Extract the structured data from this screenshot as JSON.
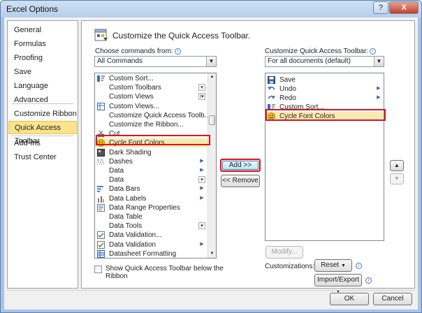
{
  "window": {
    "title": "Excel Options",
    "help": "?",
    "close": "X"
  },
  "nav": {
    "items": [
      {
        "label": "General"
      },
      {
        "label": "Formulas"
      },
      {
        "label": "Proofing"
      },
      {
        "label": "Save"
      },
      {
        "label": "Language"
      },
      {
        "label": "Advanced"
      },
      {
        "label": "Customize Ribbon"
      },
      {
        "label": "Quick Access Toolbar",
        "active": true
      },
      {
        "label": "Add-Ins"
      },
      {
        "label": "Trust Center"
      }
    ]
  },
  "header": {
    "title": "Customize the Quick Access Toolbar."
  },
  "left": {
    "choose_label": "Choose commands from:",
    "choose_value": "All Commands",
    "commands": [
      {
        "label": "Custom Sort...",
        "icon": "sort-icon"
      },
      {
        "label": "Custom Toolbars",
        "icon": "",
        "more": "box"
      },
      {
        "label": "Custom Views",
        "icon": "",
        "more": "combo"
      },
      {
        "label": "Custom Views...",
        "icon": "views-icon"
      },
      {
        "label": "Customize Quick Access Toolb...",
        "icon": ""
      },
      {
        "label": "Customize the Ribbon...",
        "icon": ""
      },
      {
        "label": "Cut",
        "icon": "scissors-icon"
      },
      {
        "label": "Cycle Font Colors",
        "icon": "smiley-icon",
        "highlight": true
      },
      {
        "label": "Dark Shading",
        "icon": "shading-icon"
      },
      {
        "label": "Dashes",
        "icon": "dashes-icon",
        "more": "arrow"
      },
      {
        "label": "Data",
        "icon": "",
        "more": "arrow"
      },
      {
        "label": "Data",
        "icon": "",
        "more": "box"
      },
      {
        "label": "Data Bars",
        "icon": "databars-icon",
        "more": "arrow"
      },
      {
        "label": "Data Labels",
        "icon": "datalabels-icon",
        "more": "arrow"
      },
      {
        "label": "Data Range Properties",
        "icon": "properties-icon"
      },
      {
        "label": "Data Table",
        "icon": ""
      },
      {
        "label": "Data Tools",
        "icon": "",
        "more": "box"
      },
      {
        "label": "Data Validation...",
        "icon": "validation-icon"
      },
      {
        "label": "Data Validation",
        "icon": "validation-icon",
        "more": "arrow"
      },
      {
        "label": "Datasheet Formatting",
        "icon": "datasheet-icon"
      }
    ],
    "show_below_label_1": "Show Quick Access Toolbar below the",
    "show_below_label_2": "Ribbon"
  },
  "middle": {
    "add": "Add >>",
    "remove": "<< Remove"
  },
  "right": {
    "customize_label": "Customize Quick Access Toolbar:",
    "customize_value": "For all documents (default)",
    "items": [
      {
        "label": "Save",
        "icon": "save-icon"
      },
      {
        "label": "Undo",
        "icon": "undo-icon",
        "more": true
      },
      {
        "label": "Redo",
        "icon": "redo-icon",
        "more": true
      },
      {
        "label": "Custom Sort...",
        "icon": "sort-icon"
      },
      {
        "label": "Cycle Font Colors",
        "icon": "smiley-icon",
        "highlight": true
      }
    ],
    "modify": "Modify...",
    "customizations_label": "Customizations:",
    "reset": "Reset",
    "import_export": "Import/Export"
  },
  "footer": {
    "ok": "OK",
    "cancel": "Cancel"
  },
  "colors": {
    "accent": "#fbe38c",
    "highlight_outline": "#d9141f",
    "window_frame": "#a9c4e4"
  }
}
